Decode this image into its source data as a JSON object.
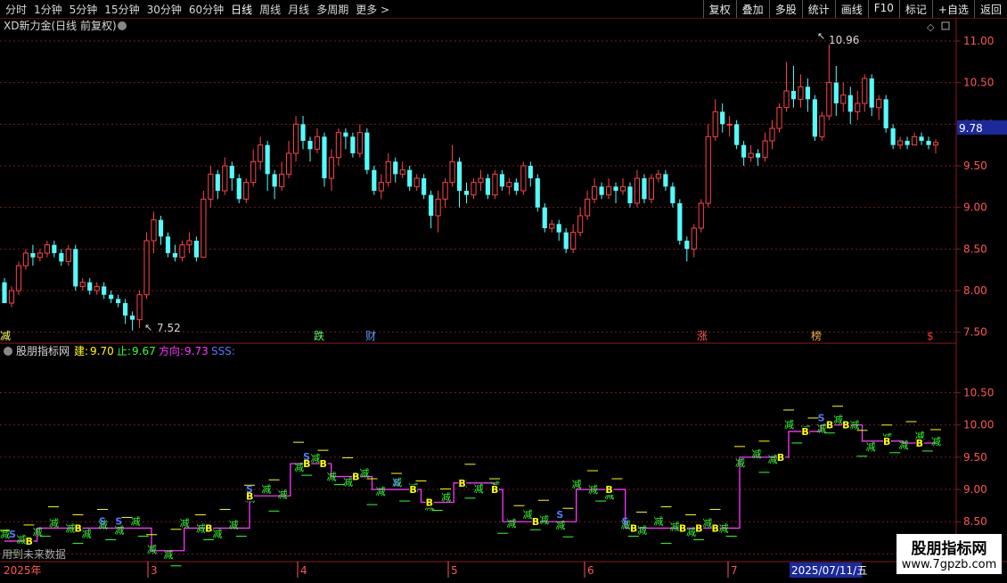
{
  "toolbar": {
    "periods": [
      "分时",
      "1分钟",
      "5分钟",
      "15分钟",
      "30分钟",
      "60分钟",
      "日线",
      "周线",
      "月线",
      "多周期",
      "更多 >"
    ],
    "active_period": "日线",
    "actions": [
      "复权",
      "叠加",
      "多股",
      "统计",
      "画线",
      "F10",
      "标记",
      "+自选",
      "返回"
    ]
  },
  "main_panel": {
    "title": "XD新力金(日线 前复权)",
    "last_price_label": "9.78",
    "high_label": "10.96",
    "low_label": "7.52",
    "y_ticks": [
      "11.00",
      "10.50",
      "10.00",
      "9.50",
      "9.00",
      "8.50",
      "8.00",
      "7.50"
    ],
    "event_markers": [
      {
        "text": "减",
        "color": "#ffff55"
      },
      {
        "text": "跌",
        "color": "#55ff55"
      },
      {
        "text": "财",
        "color": "#5599ff"
      },
      {
        "text": "涨",
        "color": "#ff5555"
      },
      {
        "text": "榜",
        "color": "#ffaa44"
      },
      {
        "text": "$",
        "color": "#ff3333"
      }
    ]
  },
  "indicator_panel": {
    "name": "股朋指标网",
    "jian_label": "建:",
    "jian_value": "9.70",
    "zhi_label": "止:",
    "zhi_value": "9.67",
    "fangxiang_label": "方向:",
    "fangxiang_value": "9.73",
    "sss_label": "SSS:",
    "y_ticks": [
      "10.50",
      "10.00",
      "9.50",
      "9.00",
      "8.50",
      "8.00"
    ],
    "signal_B": "B",
    "signal_S": "S",
    "signal_fill": "减",
    "future_data_note": "用到未来数据"
  },
  "time_axis": {
    "labels": [
      "2025年",
      "3",
      "4",
      "5",
      "6",
      "7"
    ],
    "cursor_date": "2025/07/11/五"
  },
  "watermark": {
    "line1": "股朋指标网",
    "line2": "www.7gpzb.com"
  },
  "colors": {
    "up": "#ff4444",
    "down": "#54fcfc",
    "grid": "#7a1a1a",
    "direction": "#ff33ff",
    "jian": "#ffff00",
    "zhi": "#33ff33",
    "s_sig": "#5577ff"
  },
  "chart_data": {
    "type": "candlestick",
    "ylim": [
      7.4,
      11.15
    ],
    "indicator_ylim": [
      7.95,
      10.95
    ],
    "candles": [
      [
        8.1,
        7.85,
        8.15,
        7.85
      ],
      [
        7.85,
        8.0,
        8.05,
        7.8
      ],
      [
        8.0,
        8.3,
        8.35,
        7.95
      ],
      [
        8.3,
        8.45,
        8.5,
        8.25
      ],
      [
        8.45,
        8.4,
        8.55,
        8.3
      ],
      [
        8.4,
        8.45,
        8.5,
        8.35
      ],
      [
        8.45,
        8.55,
        8.6,
        8.4
      ],
      [
        8.55,
        8.45,
        8.6,
        8.4
      ],
      [
        8.45,
        8.35,
        8.5,
        8.3
      ],
      [
        8.35,
        8.5,
        8.55,
        8.3
      ],
      [
        8.5,
        8.05,
        8.55,
        8.0
      ],
      [
        8.05,
        8.1,
        8.15,
        8.0
      ],
      [
        8.1,
        8.0,
        8.15,
        7.95
      ],
      [
        8.0,
        8.05,
        8.1,
        7.95
      ],
      [
        8.05,
        7.95,
        8.1,
        7.9
      ],
      [
        7.95,
        7.9,
        8.0,
        7.85
      ],
      [
        7.9,
        7.85,
        7.95,
        7.8
      ],
      [
        7.85,
        7.7,
        7.9,
        7.6
      ],
      [
        7.7,
        7.65,
        7.75,
        7.52
      ],
      [
        7.65,
        7.95,
        8.0,
        7.55
      ],
      [
        7.95,
        8.6,
        8.7,
        7.9
      ],
      [
        8.6,
        8.85,
        8.95,
        8.45
      ],
      [
        8.85,
        8.65,
        8.9,
        8.55
      ],
      [
        8.65,
        8.45,
        8.7,
        8.4
      ],
      [
        8.45,
        8.4,
        8.55,
        8.35
      ],
      [
        8.4,
        8.55,
        8.6,
        8.35
      ],
      [
        8.55,
        8.6,
        8.7,
        8.45
      ],
      [
        8.6,
        8.4,
        8.65,
        8.35
      ],
      [
        8.4,
        9.1,
        9.2,
        8.4
      ],
      [
        9.1,
        9.4,
        9.5,
        9.0
      ],
      [
        9.4,
        9.2,
        9.45,
        9.1
      ],
      [
        9.2,
        9.5,
        9.6,
        9.15
      ],
      [
        9.5,
        9.35,
        9.55,
        9.2
      ],
      [
        9.35,
        9.1,
        9.4,
        9.05
      ],
      [
        9.1,
        9.3,
        9.35,
        9.05
      ],
      [
        9.3,
        9.55,
        9.7,
        9.25
      ],
      [
        9.55,
        9.75,
        9.85,
        9.45
      ],
      [
        9.75,
        9.4,
        9.8,
        9.2
      ],
      [
        9.4,
        9.25,
        9.45,
        9.1
      ],
      [
        9.25,
        9.4,
        9.55,
        9.2
      ],
      [
        9.4,
        9.65,
        9.8,
        9.35
      ],
      [
        9.65,
        10.0,
        10.1,
        9.55
      ],
      [
        10.0,
        9.8,
        10.1,
        9.7
      ],
      [
        9.8,
        9.7,
        9.85,
        9.55
      ],
      [
        9.7,
        9.85,
        9.95,
        9.65
      ],
      [
        9.85,
        9.35,
        9.9,
        9.25
      ],
      [
        9.35,
        9.6,
        9.7,
        9.2
      ],
      [
        9.6,
        9.9,
        9.95,
        9.5
      ],
      [
        9.9,
        9.85,
        9.95,
        9.7
      ],
      [
        9.85,
        9.65,
        9.9,
        9.6
      ],
      [
        9.65,
        9.9,
        10.0,
        9.6
      ],
      [
        9.9,
        9.45,
        9.95,
        9.4
      ],
      [
        9.45,
        9.2,
        9.5,
        9.15
      ],
      [
        9.2,
        9.3,
        9.4,
        9.1
      ],
      [
        9.3,
        9.55,
        9.65,
        9.25
      ],
      [
        9.55,
        9.4,
        9.6,
        9.3
      ],
      [
        9.4,
        9.45,
        9.55,
        9.35
      ],
      [
        9.45,
        9.25,
        9.5,
        9.2
      ],
      [
        9.25,
        9.35,
        9.4,
        9.2
      ],
      [
        9.35,
        9.15,
        9.4,
        9.1
      ],
      [
        9.15,
        8.9,
        9.2,
        8.75
      ],
      [
        8.9,
        9.1,
        9.2,
        8.7
      ],
      [
        9.1,
        9.3,
        9.35,
        9.0
      ],
      [
        9.3,
        9.55,
        9.75,
        9.25
      ],
      [
        9.55,
        9.2,
        9.6,
        9.0
      ],
      [
        9.2,
        9.15,
        9.3,
        9.05
      ],
      [
        9.15,
        9.3,
        9.35,
        9.1
      ],
      [
        9.3,
        9.35,
        9.45,
        9.2
      ],
      [
        9.35,
        9.15,
        9.4,
        9.1
      ],
      [
        9.15,
        9.4,
        9.45,
        9.1
      ],
      [
        9.4,
        9.25,
        9.45,
        9.2
      ],
      [
        9.25,
        9.3,
        9.35,
        9.15
      ],
      [
        9.3,
        9.2,
        9.35,
        9.15
      ],
      [
        9.2,
        9.5,
        9.55,
        9.15
      ],
      [
        9.5,
        9.35,
        9.55,
        9.25
      ],
      [
        9.35,
        9.0,
        9.4,
        8.95
      ],
      [
        9.0,
        8.75,
        9.05,
        8.7
      ],
      [
        8.75,
        8.8,
        8.85,
        8.7
      ],
      [
        8.8,
        8.7,
        8.85,
        8.6
      ],
      [
        8.7,
        8.5,
        8.75,
        8.45
      ],
      [
        8.5,
        8.7,
        8.8,
        8.45
      ],
      [
        8.7,
        8.9,
        9.0,
        8.65
      ],
      [
        8.9,
        9.1,
        9.2,
        8.85
      ],
      [
        9.1,
        9.25,
        9.35,
        9.05
      ],
      [
        9.25,
        9.15,
        9.3,
        9.1
      ],
      [
        9.15,
        9.25,
        9.35,
        9.1
      ],
      [
        9.25,
        9.2,
        9.3,
        9.05
      ],
      [
        9.2,
        9.25,
        9.35,
        9.15
      ],
      [
        9.25,
        9.05,
        9.3,
        9.0
      ],
      [
        9.05,
        9.35,
        9.45,
        9.0
      ],
      [
        9.35,
        9.1,
        9.4,
        9.05
      ],
      [
        9.1,
        9.35,
        9.4,
        9.05
      ],
      [
        9.35,
        9.4,
        9.45,
        9.3
      ],
      [
        9.4,
        9.25,
        9.45,
        9.2
      ],
      [
        9.25,
        9.05,
        9.3,
        9.0
      ],
      [
        9.05,
        8.6,
        9.1,
        8.55
      ],
      [
        8.6,
        8.5,
        8.65,
        8.35
      ],
      [
        8.5,
        8.75,
        8.8,
        8.4
      ],
      [
        8.75,
        9.05,
        9.1,
        8.7
      ],
      [
        9.05,
        9.85,
        10.0,
        9.0
      ],
      [
        9.85,
        10.15,
        10.3,
        9.8
      ],
      [
        10.15,
        10.0,
        10.25,
        9.9
      ],
      [
        10.0,
        10.0,
        10.1,
        9.85
      ],
      [
        10.0,
        9.75,
        10.05,
        9.7
      ],
      [
        9.75,
        9.6,
        9.8,
        9.5
      ],
      [
        9.6,
        9.65,
        9.75,
        9.55
      ],
      [
        9.65,
        9.6,
        9.7,
        9.5
      ],
      [
        9.6,
        9.8,
        9.9,
        9.55
      ],
      [
        9.8,
        9.95,
        10.05,
        9.7
      ],
      [
        9.95,
        10.2,
        10.25,
        9.9
      ],
      [
        10.2,
        10.4,
        10.75,
        10.15
      ],
      [
        10.4,
        10.3,
        10.7,
        10.2
      ],
      [
        10.3,
        10.45,
        10.6,
        10.2
      ],
      [
        10.45,
        10.3,
        10.55,
        10.15
      ],
      [
        10.3,
        9.85,
        10.35,
        9.8
      ],
      [
        9.85,
        10.1,
        10.15,
        9.8
      ],
      [
        10.1,
        10.5,
        10.96,
        10.05
      ],
      [
        10.5,
        10.25,
        10.7,
        10.1
      ],
      [
        10.25,
        10.35,
        10.5,
        10.15
      ],
      [
        10.35,
        10.15,
        10.45,
        10.0
      ],
      [
        10.15,
        10.25,
        10.4,
        10.05
      ],
      [
        10.25,
        10.55,
        10.6,
        10.15
      ],
      [
        10.55,
        10.2,
        10.6,
        10.1
      ],
      [
        10.2,
        10.3,
        10.35,
        10.05
      ],
      [
        10.3,
        9.95,
        10.35,
        9.9
      ],
      [
        9.95,
        9.75,
        10.0,
        9.7
      ],
      [
        9.75,
        9.8,
        9.85,
        9.7
      ],
      [
        9.8,
        9.75,
        9.85,
        9.7
      ],
      [
        9.75,
        9.85,
        9.9,
        9.75
      ],
      [
        9.85,
        9.8,
        9.9,
        9.75
      ],
      [
        9.8,
        9.75,
        9.85,
        9.7
      ],
      [
        9.75,
        9.78,
        9.82,
        9.65
      ]
    ],
    "indicator": {
      "direction": [
        8.2,
        8.2,
        8.2,
        8.2,
        8.4,
        8.4,
        8.4,
        8.4,
        8.4,
        8.4,
        8.4,
        8.4,
        8.4,
        8.4,
        8.4,
        8.4,
        8.4,
        8.4,
        8.05,
        8.05,
        8.05,
        8.05,
        8.4,
        8.4,
        8.4,
        8.4,
        8.4,
        8.4,
        8.4,
        8.4,
        8.9,
        8.9,
        8.9,
        8.9,
        8.9,
        9.4,
        9.4,
        9.4,
        9.4,
        9.4,
        9.2,
        9.2,
        9.2,
        9.2,
        9.2,
        9.0,
        9.0,
        9.0,
        9.0,
        9.0,
        9.0,
        8.8,
        8.8,
        8.8,
        8.8,
        9.1,
        9.1,
        9.1,
        9.1,
        9.1,
        9.0,
        8.5,
        8.5,
        8.5,
        8.5,
        8.5,
        8.5,
        8.5,
        8.5,
        8.5,
        9.0,
        9.0,
        9.0,
        9.0,
        9.0,
        9.0,
        8.4,
        8.4,
        8.4,
        8.4,
        8.4,
        8.4,
        8.4,
        8.4,
        8.4,
        8.4,
        8.4,
        8.4,
        8.4,
        8.4,
        9.5,
        9.5,
        9.5,
        9.5,
        9.5,
        9.5,
        9.9,
        9.9,
        9.9,
        9.9,
        10.0,
        10.0,
        10.0,
        10.0,
        10.0,
        9.75,
        9.75,
        9.75,
        9.75,
        9.75,
        9.72,
        9.72,
        9.72,
        9.72,
        9.72
      ],
      "buy_idx": [
        3,
        9,
        25,
        30,
        37,
        39,
        43,
        50,
        52,
        56,
        60,
        65,
        74,
        77,
        83,
        85,
        87,
        95,
        98,
        101,
        103,
        108,
        112
      ],
      "sell_idx": [
        1,
        12,
        14,
        30,
        37,
        48,
        68,
        76,
        100
      ]
    }
  }
}
